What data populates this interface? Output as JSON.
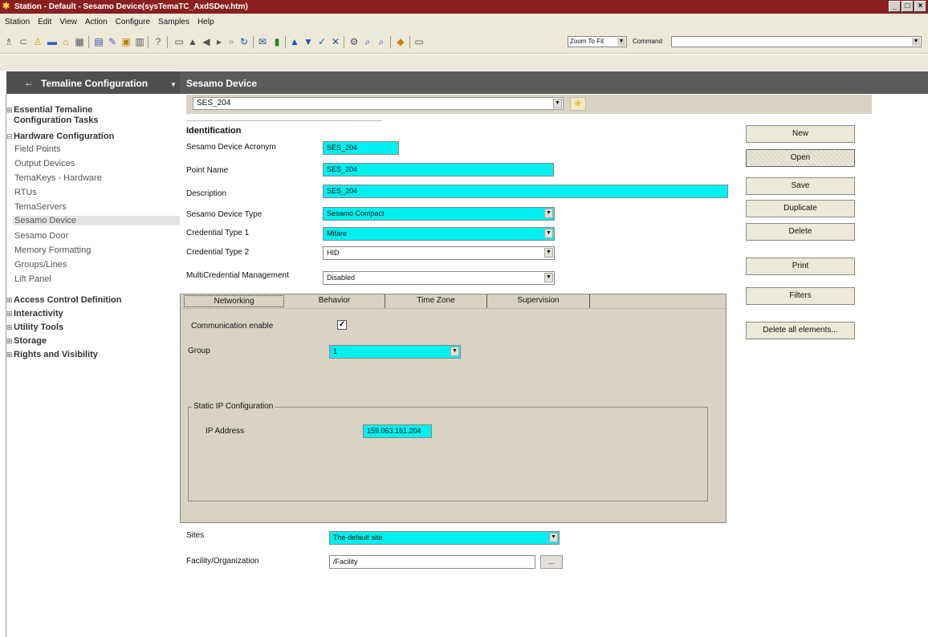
{
  "window": {
    "title": "Station - Default - Sesamo Device(sysTemaTC_AxdSDev.htm)",
    "buttons": [
      "_",
      "□",
      "×"
    ]
  },
  "menu": {
    "items": [
      {
        "label": "Station"
      },
      {
        "label": "Edit"
      },
      {
        "label": "View"
      },
      {
        "label": "Action"
      },
      {
        "label": "Configure"
      },
      {
        "label": "Samples"
      },
      {
        "label": "Help"
      }
    ]
  },
  "toolbar": {
    "zoom_value": "Zoom To Fit",
    "command_label": "Command",
    "command_value": ""
  },
  "nav": {
    "header": "Temaline Configuration",
    "sections": [
      {
        "label": "Essential Temaline",
        "label2": "Configuration Tasks",
        "state": "⊞"
      },
      {
        "label": "Hardware Configuration",
        "state": "⊟"
      },
      {
        "label": "Access Control Definition",
        "state": "⊞"
      },
      {
        "label": "Interactivity",
        "state": "⊞"
      },
      {
        "label": "Utility Tools",
        "state": "⊞"
      },
      {
        "label": "Storage",
        "state": "⊞"
      },
      {
        "label": "Rights and Visibility",
        "state": "⊞"
      }
    ],
    "hardware_items": [
      "Field Points",
      "Output Devices",
      "TemaKeys - Hardware",
      "RTUs",
      "TemaServers",
      "Sesamo Device",
      "Sesamo Door",
      "Memory Formatting",
      "Groups/Lines",
      "Lift Panel"
    ],
    "selected": "Sesamo Device"
  },
  "page": {
    "title": "Sesamo Device",
    "device_select": "SES_204"
  },
  "identification": {
    "title": "Identification",
    "fields": [
      {
        "label": "Sesamo Device Acronym",
        "value": "SES_204"
      },
      {
        "label": "Point Name",
        "value": "SES_204"
      },
      {
        "label": "Description",
        "value": "SES_204"
      },
      {
        "label": "Sesamo Device Type",
        "value": "Sesamo Compact"
      },
      {
        "label": "Credential Type 1",
        "value": "Mifare"
      },
      {
        "label": "Credential Type 2",
        "value": "HID"
      },
      {
        "label": "MultiCredential Management",
        "value": "Disabled"
      }
    ]
  },
  "actions": [
    "New",
    "Open",
    "Save",
    "Duplicate",
    "Delete",
    "Print",
    "Filters",
    "Delete all elements..."
  ],
  "tabs": [
    {
      "label": "Networking"
    },
    {
      "label": "Behavior"
    },
    {
      "label": "Time Zone"
    },
    {
      "label": "Supervision"
    }
  ],
  "networking": {
    "communication_label": "Communication enable",
    "communication_checked": "✓",
    "group_label": "Group",
    "group_value": "1",
    "static_ip_legend": "Static IP Configuration",
    "ip_label": "IP Address",
    "ip_value": "159.063.161.204"
  },
  "footer": {
    "sites_label": "Sites",
    "sites_value": "The default site",
    "facility_label": "Facility/Organization",
    "facility_value": "/Facility",
    "browse_label": "..."
  }
}
